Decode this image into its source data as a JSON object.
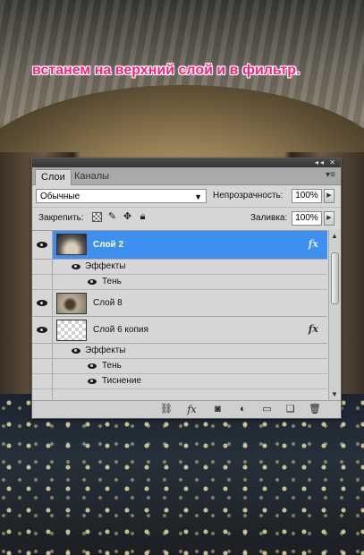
{
  "caption": "встанем на верхний слой и в фильтр.",
  "panel": {
    "tabs": [
      {
        "label": "Слои",
        "active": true
      },
      {
        "label": "Каналы",
        "active": false
      }
    ],
    "blend_mode": "Обычные",
    "opacity_label": "Непрозрачность:",
    "opacity_value": "100%",
    "lock_label": "Закрепить:",
    "fill_label": "Заливка:",
    "fill_value": "100%",
    "menu_icon": "panel-menu-icon"
  },
  "layers": [
    {
      "name": "Слой 2",
      "selected": true,
      "has_fx": true,
      "effects_label": "Эффекты",
      "effects": [
        "Тень"
      ]
    },
    {
      "name": "Слой 8",
      "selected": false,
      "has_fx": false
    },
    {
      "name": "Слой 6 копия",
      "selected": false,
      "has_fx": true,
      "effects_label": "Эффекты",
      "effects": [
        "Тень",
        "Тиснение"
      ]
    }
  ],
  "fx_label": "fx",
  "colors": {
    "caption": "#ff1f7a",
    "selection": "#3d8ff0",
    "panel_bg": "#d6d6d6"
  }
}
